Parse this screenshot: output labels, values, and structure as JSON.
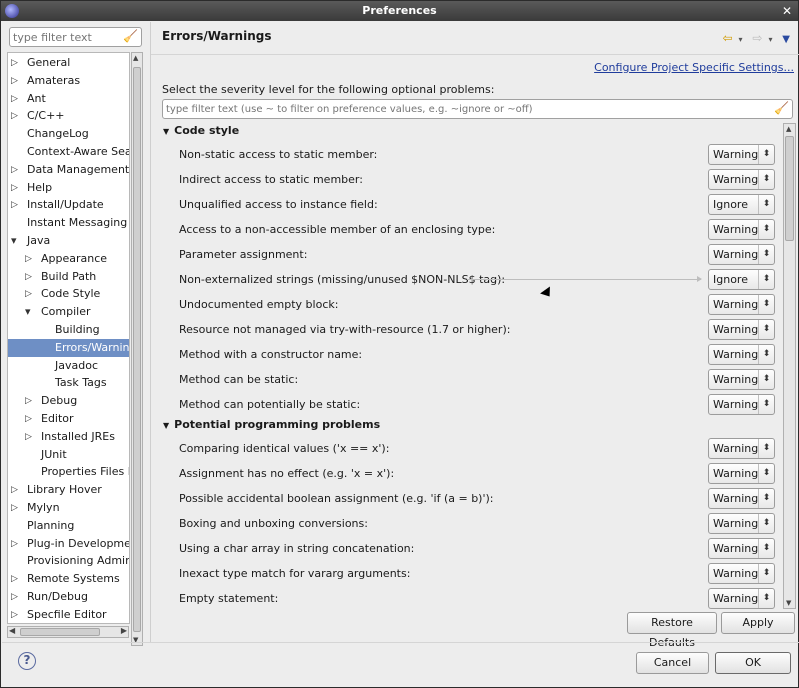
{
  "window": {
    "title": "Preferences"
  },
  "sidebar": {
    "filter_placeholder": "type filter text",
    "items": [
      {
        "label": "General",
        "level": 0,
        "twisty": "closed"
      },
      {
        "label": "Amateras",
        "level": 0,
        "twisty": "closed"
      },
      {
        "label": "Ant",
        "level": 0,
        "twisty": "closed"
      },
      {
        "label": "C/C++",
        "level": 0,
        "twisty": "closed"
      },
      {
        "label": "ChangeLog",
        "level": 0,
        "twisty": "none"
      },
      {
        "label": "Context-Aware Searc",
        "level": 0,
        "twisty": "none"
      },
      {
        "label": "Data Management",
        "level": 0,
        "twisty": "closed"
      },
      {
        "label": "Help",
        "level": 0,
        "twisty": "closed"
      },
      {
        "label": "Install/Update",
        "level": 0,
        "twisty": "closed"
      },
      {
        "label": "Instant Messaging",
        "level": 0,
        "twisty": "none"
      },
      {
        "label": "Java",
        "level": 0,
        "twisty": "open"
      },
      {
        "label": "Appearance",
        "level": 1,
        "twisty": "closed"
      },
      {
        "label": "Build Path",
        "level": 1,
        "twisty": "closed"
      },
      {
        "label": "Code Style",
        "level": 1,
        "twisty": "closed"
      },
      {
        "label": "Compiler",
        "level": 1,
        "twisty": "open"
      },
      {
        "label": "Building",
        "level": 2,
        "twisty": "none"
      },
      {
        "label": "Errors/Warning",
        "level": 2,
        "twisty": "none",
        "selected": true
      },
      {
        "label": "Javadoc",
        "level": 2,
        "twisty": "none"
      },
      {
        "label": "Task Tags",
        "level": 2,
        "twisty": "none"
      },
      {
        "label": "Debug",
        "level": 1,
        "twisty": "closed"
      },
      {
        "label": "Editor",
        "level": 1,
        "twisty": "closed"
      },
      {
        "label": "Installed JREs",
        "level": 1,
        "twisty": "closed"
      },
      {
        "label": "JUnit",
        "level": 1,
        "twisty": "none"
      },
      {
        "label": "Properties Files Ec",
        "level": 1,
        "twisty": "none"
      },
      {
        "label": "Library Hover",
        "level": 0,
        "twisty": "closed"
      },
      {
        "label": "Mylyn",
        "level": 0,
        "twisty": "closed"
      },
      {
        "label": "Planning",
        "level": 0,
        "twisty": "none"
      },
      {
        "label": "Plug-in Development",
        "level": 0,
        "twisty": "closed"
      },
      {
        "label": "Provisioning Admin",
        "level": 0,
        "twisty": "none"
      },
      {
        "label": "Remote Systems",
        "level": 0,
        "twisty": "closed"
      },
      {
        "label": "Run/Debug",
        "level": 0,
        "twisty": "closed"
      },
      {
        "label": "Specfile Editor",
        "level": 0,
        "twisty": "closed"
      }
    ]
  },
  "main": {
    "title": "Errors/Warnings",
    "configure_link": "Configure Project Specific Settings...",
    "select_label": "Select the severity level for the following optional problems:",
    "filter_placeholder": "type filter text (use ~ to filter on preference values, e.g. ~ignore or ~off)",
    "sections": [
      {
        "title": "Code style",
        "rows": [
          {
            "label": "Non-static access to static member:",
            "value": "Warning"
          },
          {
            "label": "Indirect access to static member:",
            "value": "Warning"
          },
          {
            "label": "Unqualified access to instance field:",
            "value": "Ignore"
          },
          {
            "label": "Access to a non-accessible member of an enclosing type:",
            "value": "Warning"
          },
          {
            "label": "Parameter assignment:",
            "value": "Warning"
          },
          {
            "label": "Non-externalized strings (missing/unused $NON-NLS$ tag):",
            "value": "Ignore",
            "hover": true
          },
          {
            "label": "Undocumented empty block:",
            "value": "Warning"
          },
          {
            "label": "Resource not managed via try-with-resource (1.7 or higher):",
            "value": "Warning"
          },
          {
            "label": "Method with a constructor name:",
            "value": "Warning"
          },
          {
            "label": "Method can be static:",
            "value": "Warning"
          },
          {
            "label": "Method can potentially be static:",
            "value": "Warning"
          }
        ]
      },
      {
        "title": "Potential programming problems",
        "rows": [
          {
            "label": "Comparing identical values ('x == x'):",
            "value": "Warning"
          },
          {
            "label": "Assignment has no effect (e.g. 'x = x'):",
            "value": "Warning"
          },
          {
            "label": "Possible accidental boolean assignment (e.g. 'if (a = b)'):",
            "value": "Warning"
          },
          {
            "label": "Boxing and unboxing conversions:",
            "value": "Warning"
          },
          {
            "label": "Using a char array in string concatenation:",
            "value": "Warning"
          },
          {
            "label": "Inexact type match for vararg arguments:",
            "value": "Warning"
          },
          {
            "label": "Empty statement:",
            "value": "Warning"
          }
        ]
      }
    ],
    "restore_label": "Restore Defaults",
    "apply_label": "Apply"
  },
  "footer": {
    "help_symbol": "?",
    "cancel_label": "Cancel",
    "ok_label": "OK"
  },
  "colors": {
    "selection": "#6e8fc5",
    "link": "#1f3c9c"
  },
  "icons": [
    "app-icon",
    "close-icon",
    "clear-filter-icon",
    "back-icon",
    "forward-icon",
    "menu-icon",
    "help-icon",
    "twisty-icon",
    "spinner-icon"
  ]
}
